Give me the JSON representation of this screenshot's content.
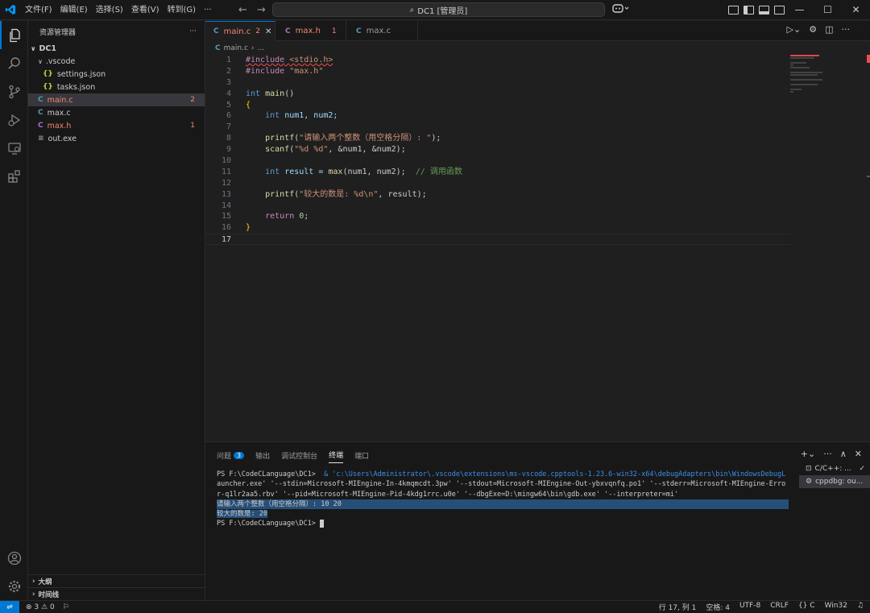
{
  "titlebar": {
    "menu": [
      "文件(F)",
      "编辑(E)",
      "选择(S)",
      "查看(V)",
      "转到(G)",
      "···"
    ],
    "search_text": "DC1 [管理员]"
  },
  "sidebar": {
    "title": "资源管理器",
    "more": "···",
    "root": "DC1",
    "items": [
      {
        "label": ".vscode",
        "type": "folder"
      },
      {
        "label": "settings.json",
        "type": "json"
      },
      {
        "label": "tasks.json",
        "type": "json"
      },
      {
        "label": "main.c",
        "type": "c",
        "badge": "2"
      },
      {
        "label": "max.c",
        "type": "c",
        "badge": ""
      },
      {
        "label": "max.h",
        "type": "h",
        "badge": "1"
      },
      {
        "label": "out.exe",
        "type": "exe",
        "badge": ""
      }
    ],
    "outline": "大纲",
    "timeline": "时间线"
  },
  "tabs": [
    {
      "label": "main.c",
      "count": "2",
      "active": true
    },
    {
      "label": "max.h",
      "count": "1",
      "active": false
    },
    {
      "label": "max.c",
      "count": "",
      "active": false
    }
  ],
  "breadcrumb": {
    "file": "main.c",
    "rest": "..."
  },
  "code": {
    "l1_pp": "#include",
    "l1_inc": "<stdio.h>",
    "l2_pp": "#include",
    "l2_inc": "\"max.h\"",
    "l4_kw": "int",
    "l4_fn": "main",
    "l4_rest": "()",
    "l5": "{",
    "l6_kw": "int",
    "l6_rest": "num1, num2;",
    "l8_fn": "printf",
    "l8_str": "\"请输入两个整数（用空格分隔）: \"",
    "l8_end": ");",
    "l9_fn": "scanf",
    "l9_str": "\"%d %d\"",
    "l9_rest": ", &num1, &num2);",
    "l11_kw": "int",
    "l11_a": "result = ",
    "l11_fn": "max",
    "l11_b": "(num1, num2);",
    "l11_cm": "// 调用函数",
    "l13_fn": "printf",
    "l13_str": "\"较大的数是: %d\\n\"",
    "l13_rest": ", result);",
    "l15_kw": "return",
    "l15_num": "0",
    "l15_end": ";",
    "l16": "}",
    "line_numbers": [
      "1",
      "2",
      "3",
      "4",
      "5",
      "6",
      "7",
      "8",
      "9",
      "10",
      "11",
      "12",
      "13",
      "14",
      "15",
      "16",
      "17"
    ]
  },
  "panel": {
    "tabs": [
      "问题",
      "输出",
      "调试控制台",
      "终端",
      "端口"
    ],
    "problem_count": "3",
    "terminal_lines": [
      "PS F:\\CodeCLanguage\\DC1>",
      "& 'c:\\Users\\Administrator\\.vscode\\extensions\\ms-vscode.cpptools-1.23.6-win32-x64\\debugAdapters\\bin\\WindowsDebugL",
      "auncher.exe' '--stdin=Microsoft-MIEngine-In-4kmqmcdt.3pw' '--stdout=Microsoft-MIEngine-Out-ybxvqnfq.po1' '--stderr=Microsoft-MIEngine-Erro",
      "r-q1lr2aa5.rbv' '--pid=Microsoft-MIEngine-Pid-4kdg1rrc.u0e' '--dbgExe=D:\\mingw64\\bin\\gdb.exe' '--interpreter=mi'",
      "请输入两个整数（用空格分隔）: 10 20",
      "较大的数是: 20",
      "PS F:\\CodeCLanguage\\DC1>"
    ],
    "terminals": [
      "C/C++: ...",
      "cppdbg: ou..."
    ]
  },
  "statusbar": {
    "errors": "3",
    "warnings": "0",
    "position": "行 17, 列 1",
    "spaces": "空格: 4",
    "encoding": "UTF-8",
    "eol": "CRLF",
    "language": "{} C",
    "platform": "Win32"
  },
  "colors": {
    "accent": "#0078d4",
    "error": "#f48771",
    "background": "#1f1f1f"
  }
}
